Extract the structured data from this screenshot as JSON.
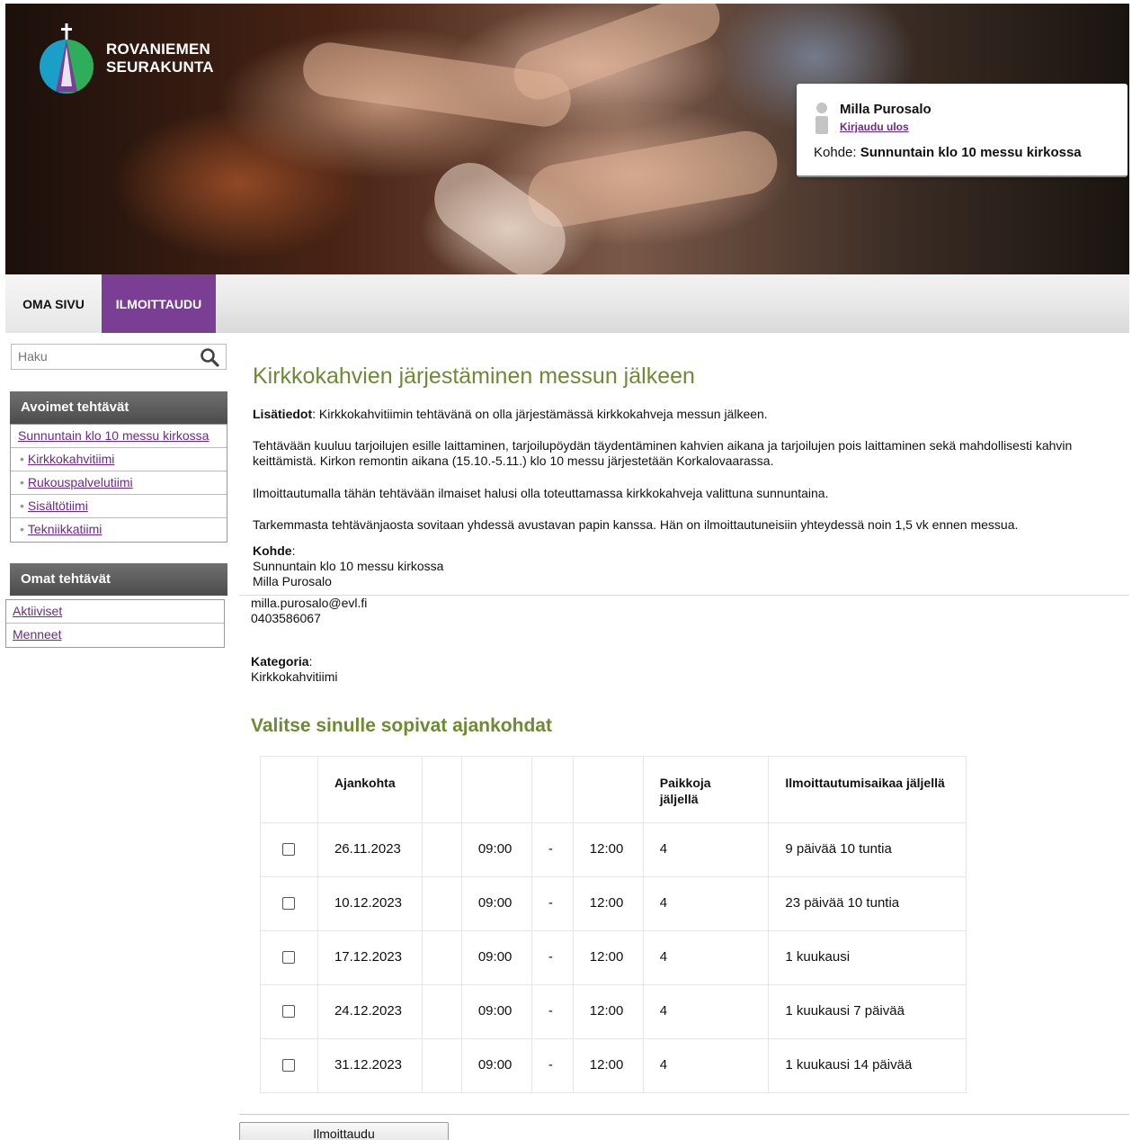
{
  "brand": {
    "line1": "ROVANIEMEN",
    "line2": "SEURAKUNTA"
  },
  "user": {
    "name": "Milla Purosalo",
    "logout": "Kirjaudu ulos",
    "target_label": "Kohde:",
    "target_value": "Sunnuntain klo 10 messu kirkossa"
  },
  "nav": {
    "tabs": [
      "OMA SIVU",
      "ILMOITTAUDU"
    ],
    "active": "ILMOITTAUDU",
    "active_color": "#7a3f95"
  },
  "search": {
    "placeholder": "Haku"
  },
  "sidebar": {
    "open_title": "Avoimet tehtävät",
    "open_items": [
      "Sunnuntain klo 10 messu kirkossa",
      "Kirkkokahvitiimi",
      "Rukouspalvelutiimi",
      "Sisältötiimi",
      "Tekniikkatiimi"
    ],
    "own_title": "Omat tehtävät",
    "own_items": [
      "Aktiiviset",
      "Menneet"
    ]
  },
  "main": {
    "title": "Kirkkokahvien järjestäminen messun jälkeen",
    "info_label": "Lisätiedot",
    "info_text": ": Kirkkokahvitiimin tehtävänä on olla järjestämässä kirkkokahveja messun jälkeen.",
    "p2": "Tehtävään kuuluu tarjoilujen esille laittaminen, tarjoilupöydän täydentäminen kahvien aikana ja tarjoilujen pois laittaminen sekä mahdollisesti kahvin keittämistä. Kirkon remontin aikana (15.10.-5.11.) klo 10 messu järjestetään Korkalovaarassa.",
    "p3": "Ilmoittautumalla tähän tehtävään ilmaiset halusi olla toteuttamassa kirkkokahveja valittuna sunnuntaina.",
    "p4": "Tarkemmasta tehtävänjaosta sovitaan yhdessä avustavan papin kanssa. Hän on ilmoittautuneisiin yhteydessä noin 1,5 vk ennen messua.",
    "kohde_label": "Kohde",
    "kohde_place": "Sunnuntain klo 10 messu kirkossa",
    "kohde_person": "Milla Purosalo",
    "kohde_email": "milla.purosalo@evl.fi",
    "kohde_phone": "0403586067",
    "kategoria_label": "Kategoria",
    "kategoria_value": "Kirkkokahvitiimi",
    "slots_title": "Valitse sinulle sopivat ajankohdat",
    "colon": ":"
  },
  "table": {
    "headers": [
      "Ajankohta",
      "Paikkoja jäljellä",
      "Ilmoittautumisaikaa jäljellä"
    ],
    "rows": [
      {
        "date": "26.11.2023",
        "start": "09:00",
        "sep": "-",
        "end": "12:00",
        "places": "4",
        "remaining": "9 päivää 10 tuntia"
      },
      {
        "date": "10.12.2023",
        "start": "09:00",
        "sep": "-",
        "end": "12:00",
        "places": "4",
        "remaining": "23 päivää 10 tuntia"
      },
      {
        "date": "17.12.2023",
        "start": "09:00",
        "sep": "-",
        "end": "12:00",
        "places": "4",
        "remaining": "1 kuukausi"
      },
      {
        "date": "24.12.2023",
        "start": "09:00",
        "sep": "-",
        "end": "12:00",
        "places": "4",
        "remaining": "1 kuukausi 7 päivää"
      },
      {
        "date": "31.12.2023",
        "start": "09:00",
        "sep": "-",
        "end": "12:00",
        "places": "4",
        "remaining": "1 kuukausi 14 päivää"
      }
    ]
  },
  "submit": {
    "label": "Ilmoittaudu"
  },
  "colors": {
    "accent_green": "#6c8b33",
    "link_purple": "#6b2a88"
  }
}
